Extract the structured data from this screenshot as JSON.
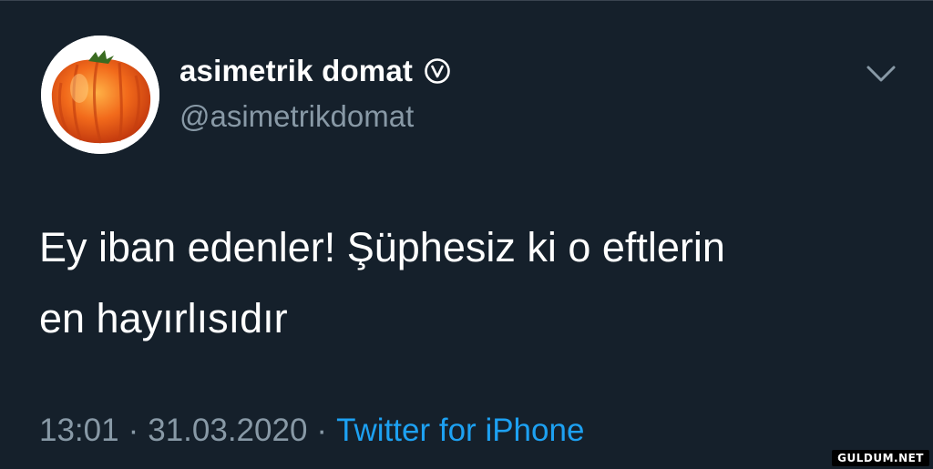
{
  "user": {
    "display_name": "asimetrik domat",
    "handle": "@asimetrikdomat",
    "verified_icon": "verified-badge-icon",
    "avatar_icon": "tomato-avatar"
  },
  "tweet": {
    "text": "Ey iban edenler! Şüphesiz ki o eftlerin\nen hayırlısıdır"
  },
  "meta": {
    "time": "13:01",
    "separator": "·",
    "date": "31.03.2020",
    "source": "Twitter for iPhone"
  },
  "watermark": {
    "text": "GULDUM.NET"
  },
  "colors": {
    "background": "#15202b",
    "text": "#ffffff",
    "secondary": "#8899a6",
    "link": "#1da1f2"
  }
}
